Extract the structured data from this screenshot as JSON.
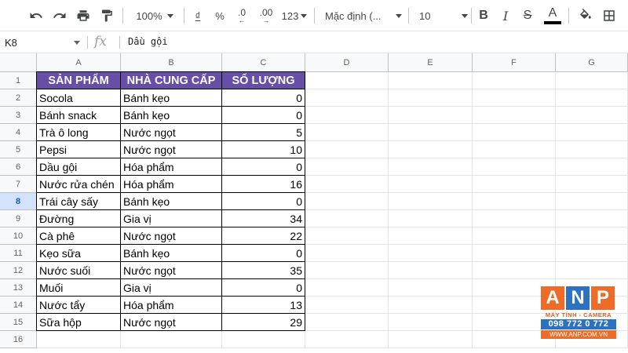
{
  "toolbar": {
    "zoom": "100%",
    "currency": "₫",
    "percent": "%",
    "decrease_decimal": ".0",
    "increase_decimal": ".00",
    "more_formats": "123",
    "font": "Mặc định (...",
    "font_size": "10",
    "text_color": "#000000"
  },
  "formula_bar": {
    "cell_ref": "K8",
    "fx_label": "fx",
    "content": "Dầu gội"
  },
  "grid": {
    "columns": [
      "A",
      "B",
      "C",
      "D",
      "E",
      "F",
      "G"
    ],
    "rows": [
      "1",
      "2",
      "3",
      "4",
      "5",
      "6",
      "7",
      "8",
      "9",
      "10",
      "11",
      "12",
      "13",
      "14",
      "15",
      "16"
    ],
    "selected_row": "8",
    "header_fill": "#674ea7"
  },
  "table": {
    "headers": [
      "SẢN PHẨM",
      "NHÀ CUNG CẤP",
      "SỐ LƯỢNG"
    ],
    "rows": [
      [
        "Socola",
        "Bánh kẹo",
        "0"
      ],
      [
        "Bánh snack",
        "Bánh kẹo",
        "0"
      ],
      [
        "Trà ô long",
        "Nước ngọt",
        "5"
      ],
      [
        "Pepsi",
        "Nước ngọt",
        "10"
      ],
      [
        "Dầu gội",
        "Hóa phẩm",
        "0"
      ],
      [
        "Nước rửa chén",
        "Hóa phẩm",
        "16"
      ],
      [
        "Trái cây sấy",
        "Bánh kẹo",
        "0"
      ],
      [
        "Đường",
        "Gia vị",
        "34"
      ],
      [
        "Cà phê",
        "Nước ngọt",
        "22"
      ],
      [
        "Kẹo sữa",
        "Bánh kẹo",
        "0"
      ],
      [
        "Nước suối",
        "Nước ngọt",
        "35"
      ],
      [
        "Muối",
        "Gia vị",
        "0"
      ],
      [
        "Nước tẩy",
        "Hóa phẩm",
        "13"
      ],
      [
        "Sữa hộp",
        "Nước ngọt",
        "29"
      ]
    ]
  },
  "watermark": {
    "letters": [
      "A",
      "N",
      "P"
    ],
    "tagline": "MÁY TÍNH - CAMERA",
    "phone": "098 772 0 772",
    "website": "WWW.ANP.COM.VN"
  }
}
